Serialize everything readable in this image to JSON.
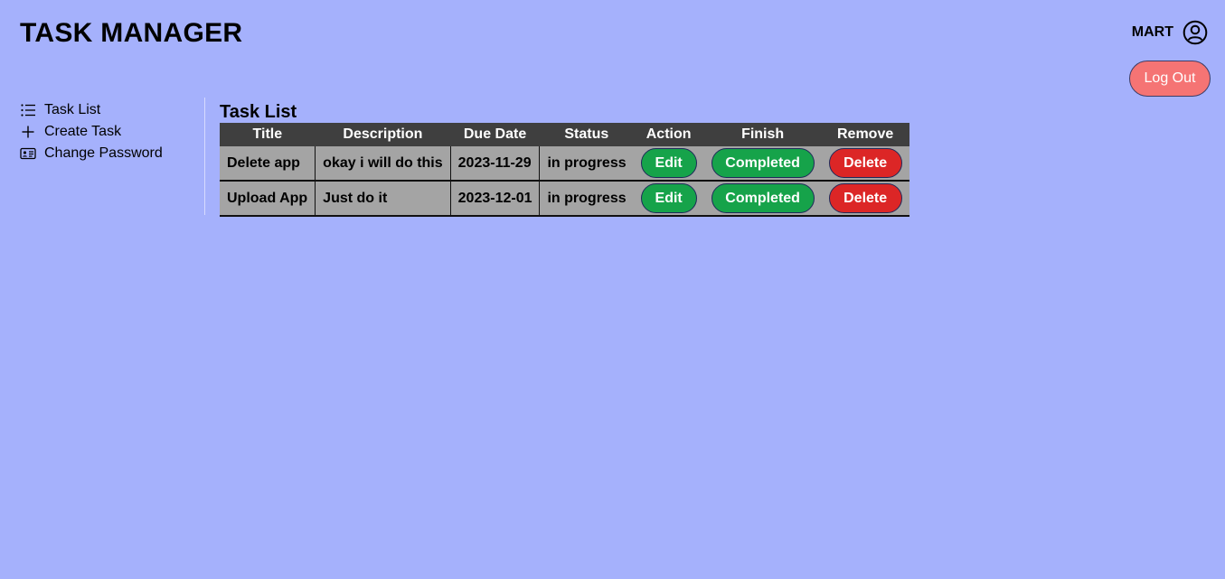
{
  "header": {
    "app_title": "TASK MANAGER",
    "username": "MART",
    "logout_label": "Log Out"
  },
  "sidebar": {
    "items": [
      {
        "label": "Task List",
        "icon": "list-icon"
      },
      {
        "label": "Create Task",
        "icon": "plus-icon"
      },
      {
        "label": "Change Password",
        "icon": "id-card-icon"
      }
    ]
  },
  "main": {
    "title": "Task List",
    "table": {
      "headers": [
        "Title",
        "Description",
        "Due Date",
        "Status",
        "Action",
        "Finish",
        "Remove"
      ],
      "rows": [
        {
          "title": "Delete app",
          "description": "okay i will do this",
          "due_date": "2023-11-29",
          "status": "in progress",
          "action_label": "Edit",
          "finish_label": "Completed",
          "remove_label": "Delete"
        },
        {
          "title": "Upload App",
          "description": "Just do it",
          "due_date": "2023-12-01",
          "status": "in progress",
          "action_label": "Edit",
          "finish_label": "Completed",
          "remove_label": "Delete"
        }
      ]
    }
  },
  "colors": {
    "background": "#a5b1fc",
    "logout": "#f57474",
    "completed": "#16a34a",
    "delete": "#dc2626",
    "table_header": "#3f3f3f",
    "table_cell": "#a4a4a4"
  }
}
